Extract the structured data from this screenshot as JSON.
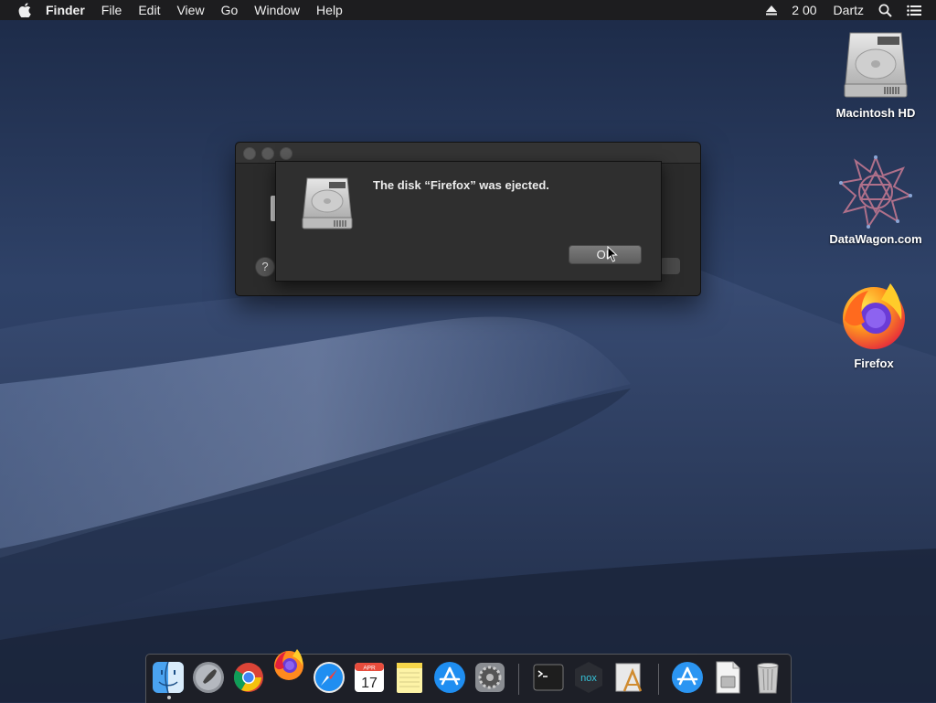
{
  "menubar": {
    "app_name": "Finder",
    "menus": [
      "File",
      "Edit",
      "View",
      "Go",
      "Window",
      "Help"
    ],
    "clock": "2 00",
    "user": "Dartz",
    "icons": [
      "apple-icon",
      "eject-icon",
      "spotlight-icon",
      "notification-center-icon"
    ]
  },
  "desktop": {
    "icons": [
      {
        "label": "Macintosh HD",
        "icon": "hard-drive-icon"
      },
      {
        "label": "DataWagon.com",
        "icon": "network-volume-icon"
      },
      {
        "label": "Firefox",
        "icon": "firefox-icon"
      }
    ]
  },
  "alert": {
    "message": "The disk “Firefox” was ejected.",
    "ok_label": "OK",
    "help_label": "?"
  },
  "dock": {
    "items": [
      "Finder",
      "Launchpad",
      "Google Chrome",
      "Firefox",
      "Safari",
      "Calendar",
      "Notes",
      "App Store",
      "System Preferences",
      "Terminal",
      "NoxPlayer",
      "Script Editor",
      "App Store Downloads",
      "Disk Image",
      "Trash"
    ],
    "calendar_month": "APR",
    "calendar_day": "17",
    "nox_label": "nox"
  },
  "colors": {
    "menubar_bg": "#1d1d1f",
    "window_bg": "#2b2b2b",
    "sheet_bg": "#2f2f2f",
    "dock_bg": "#1e1e22"
  }
}
